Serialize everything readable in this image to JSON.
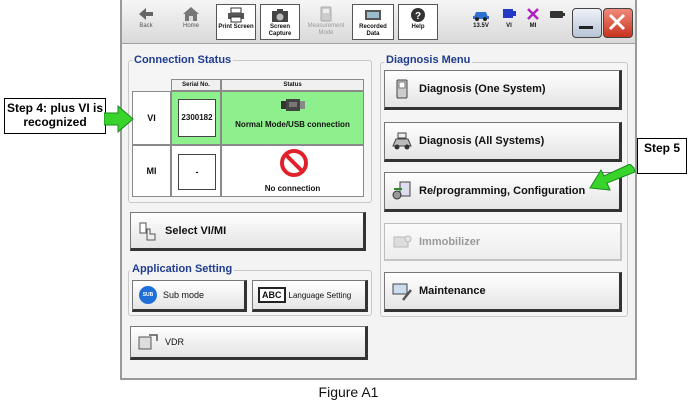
{
  "toolbar": {
    "items": [
      {
        "label": "Back"
      },
      {
        "label": "Home"
      },
      {
        "label": "Print Screen"
      },
      {
        "label": "Screen Capture"
      },
      {
        "label": "Measurement Mode"
      },
      {
        "label": "Recorded Data"
      },
      {
        "label": "Help"
      }
    ],
    "voltage": "13.5V",
    "vi_label": "VI",
    "mi_label": "MI"
  },
  "connection_status": {
    "title": "Connection Status",
    "col_serial": "Serial No.",
    "col_status": "Status",
    "vi": {
      "label": "VI",
      "serial": "2300182",
      "status": "Normal Mode/USB connection"
    },
    "mi": {
      "label": "MI",
      "serial": "-",
      "status": "No connection"
    },
    "select_button": "Select VI/MI"
  },
  "application_setting": {
    "title": "Application Setting",
    "sub_mode": "Sub mode",
    "sub_icon_text": "SUB",
    "language": "Language Setting",
    "abc_text": "ABC"
  },
  "vdr_button": "VDR",
  "diagnosis_menu": {
    "title": "Diagnosis Menu",
    "one_system": "Diagnosis (One System)",
    "all_systems": "Diagnosis (All Systems)",
    "reprogramming": "Re/programming, Configuration",
    "immobilizer": "Immobilizer",
    "maintenance": "Maintenance"
  },
  "callouts": {
    "step4": "Step 4: plus VI is recognized",
    "step5": "Step 5"
  },
  "caption": "Figure A1",
  "colors": {
    "green_status": "#8ef08c",
    "panel_title": "#1f3c8f",
    "callout_arrow": "#38d42c",
    "no_entry": "#e0202a"
  }
}
